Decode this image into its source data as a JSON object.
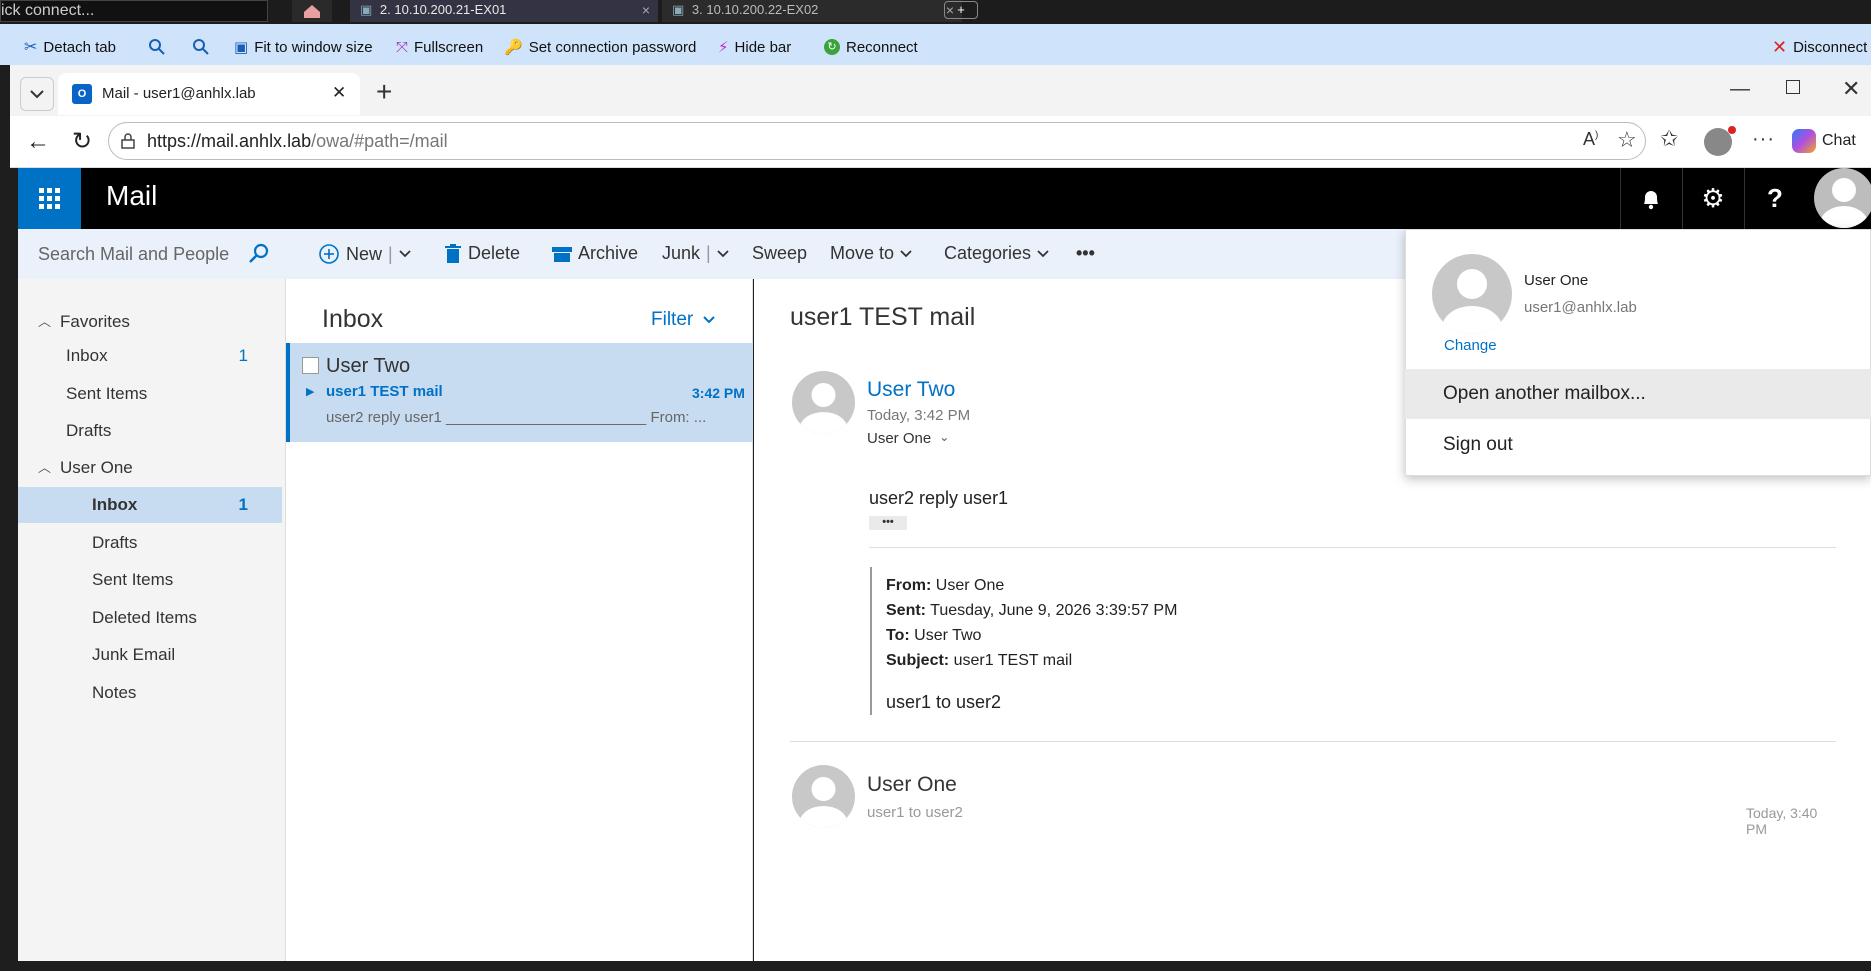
{
  "rd_manager": {
    "quick_connect": "ick connect...",
    "tabs": [
      {
        "label": "2. 10.10.200.21-EX01",
        "close": "×"
      },
      {
        "label": "3. 10.10.200.22-EX02",
        "close": "×"
      }
    ],
    "new_tab": "+",
    "toolbar": {
      "detach": "Detach tab",
      "fit": "Fit to window size",
      "fullscreen": "Fullscreen",
      "set_password": "Set connection password",
      "hide_bar": "Hide bar",
      "reconnect": "Reconnect",
      "disconnect": "Disconnect"
    }
  },
  "browser": {
    "tab_title": "Mail - user1@anhlx.lab",
    "url_host": "https://mail.anhlx.lab",
    "url_path": "/owa/#path=/mail",
    "chat_label": "Chat",
    "close_tab": "✕",
    "new_tab": "+"
  },
  "owa": {
    "app_title": "Mail",
    "search_placeholder": "Search Mail and People",
    "commands": {
      "new": "New",
      "delete": "Delete",
      "archive": "Archive",
      "junk": "Junk",
      "sweep": "Sweep",
      "move_to": "Move to",
      "categories": "Categories",
      "more": "•••"
    },
    "nav": {
      "favorites_label": "Favorites",
      "favorites": [
        {
          "label": "Inbox",
          "count": "1"
        },
        {
          "label": "Sent Items",
          "count": ""
        },
        {
          "label": "Drafts",
          "count": ""
        }
      ],
      "account_label": "User One",
      "folders": [
        {
          "label": "Inbox",
          "count": "1"
        },
        {
          "label": "Drafts",
          "count": ""
        },
        {
          "label": "Sent Items",
          "count": ""
        },
        {
          "label": "Deleted Items",
          "count": ""
        },
        {
          "label": "Junk Email",
          "count": ""
        },
        {
          "label": "Notes",
          "count": ""
        }
      ]
    },
    "list": {
      "title": "Inbox",
      "filter": "Filter",
      "items": [
        {
          "sender": "User Two",
          "subject": "user1 TEST mail",
          "time": "3:42 PM",
          "preview": "user2 reply user1 ________________________ From: ..."
        }
      ]
    },
    "reading": {
      "subject": "user1 TEST mail",
      "message": {
        "sender": "User Two",
        "date": "Today, 3:42 PM",
        "to": "User One",
        "body": "user2 reply user1",
        "more": "•••",
        "quoted": {
          "from_label": "From:",
          "from": "User One",
          "sent_label": "Sent:",
          "sent": "Tuesday, June 9, 2026 3:39:57 PM",
          "to_label": "To:",
          "to": "User Two",
          "subject_label": "Subject:",
          "subject": "user1 TEST mail",
          "body": "user1 to user2"
        }
      },
      "earlier": {
        "sender": "User One",
        "preview": "user1 to user2",
        "time": "Today, 3:40 PM"
      }
    },
    "account_menu": {
      "name": "User One",
      "email": "user1@anhlx.lab",
      "change": "Change",
      "open_mailbox": "Open another mailbox...",
      "sign_out": "Sign out"
    }
  },
  "colors": {
    "accent": "#0072c6",
    "toolbar_bg": "#cfe3fb",
    "selected": "#c7dcf0"
  }
}
